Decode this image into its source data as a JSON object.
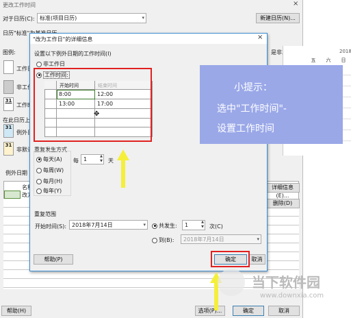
{
  "outer": {
    "title": "更改工作时间",
    "for_calendar_label": "对于日历(C):",
    "calendar_value": "标准(项目日历)",
    "new_calendar_btn": "新建日历(N)...",
    "base_note": "日历\"标准\"为基准日历。",
    "legend_label": "图例:",
    "legend_workday": "工作日",
    "legend_nonworkday": "非工作日",
    "legend_edited": "工作时",
    "legend_31": "31",
    "in_calendar": "在此日历上",
    "exception_day": "例外日",
    "nondefault": "非默认",
    "exceptions_tab": "例外日期",
    "non_work_note": "是非工作日。",
    "cal_year": "2018",
    "cal_days": [
      "五",
      "六",
      "日"
    ],
    "detail_btn": "详细信息(E)...",
    "delete_btn": "删除(D)",
    "table_row_name": "名称",
    "table_row_val": "改方",
    "help_btn": "帮助(H)",
    "options_btn": "选项(P)...",
    "ok_btn": "确定",
    "cancel_btn": "取消"
  },
  "dialog": {
    "title": "\"改为工作日\"的详细信息",
    "close_icon": "×",
    "set_times_label": "设置以下例外日期的工作时间(I)",
    "nonworking_radio": "非工作日",
    "working_radio": "工作时间:",
    "table_headers": [
      "开始时间",
      "结束时间"
    ],
    "rows": [
      [
        "8:00",
        "12:00"
      ],
      [
        "13:00",
        "17:00"
      ],
      [
        "",
        ""
      ],
      [
        "",
        ""
      ],
      [
        "",
        ""
      ]
    ],
    "recurrence_label": "重复发生方式",
    "recurrence_options": [
      "每天(A)",
      "每周(W)",
      "每月(H)",
      "每年(Y)"
    ],
    "every_label": "每",
    "every_value": "1",
    "every_unit": "天",
    "range_label": "重复范围",
    "start_label": "开始时间(S):",
    "start_value": "2018年7月14日",
    "occurrences_radio": "共发生:",
    "occurrences_value": "1",
    "occurrences_unit": "次(C)",
    "to_radio": "到(B):",
    "to_value": "2018年7月14日",
    "help_btn": "帮助(P)",
    "ok_btn": "确定",
    "cancel_btn": "取消"
  },
  "tip": {
    "title": "小提示：",
    "line1": "选中\"工作时间\"-",
    "line2": "设置工作时间"
  },
  "watermark": {
    "brand": "当下软件园",
    "url": "www.downxia.com"
  },
  "colors": {
    "highlight_red": "#e0201f",
    "arrow_yellow": "#f5ef3a",
    "tip_bg": "#9aa8e8",
    "dialog_border": "#3a8ccf"
  }
}
